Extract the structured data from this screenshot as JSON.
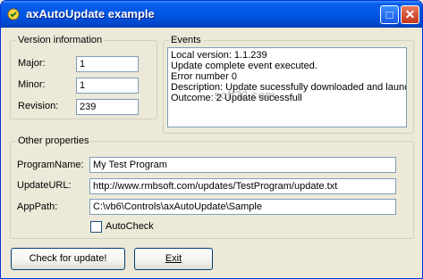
{
  "window": {
    "title": "axAutoUpdate example"
  },
  "titlebar_buttons": {
    "maximize": "□",
    "close": "✕"
  },
  "version_info": {
    "legend": "Version information",
    "major_label": "Major:",
    "major_value": "1",
    "minor_label": "Minor:",
    "minor_value": "1",
    "revision_label": "Revision:",
    "revision_value": "239"
  },
  "events": {
    "legend": "Events",
    "lines": [
      "Local version: 1.1.239",
      "Update complete event executed.",
      "Error number 0",
      "Description: Update sucessfully downloaded and launc",
      "Outcome: 2 Update sucessfull"
    ]
  },
  "other_properties": {
    "legend": "Other properties",
    "program_name_label": "ProgramName:",
    "program_name_value": "My Test Program",
    "update_url_label": "UpdateURL:",
    "update_url_value": "http://www.rmbsoft.com/updates/TestProgram/update.txt",
    "app_path_label": "AppPath:",
    "app_path_value": "C:\\vb6\\Controls\\axAutoUpdate\\Sample",
    "autocheck_label": "AutoCheck",
    "autocheck_checked": false
  },
  "buttons": {
    "check": "Check for update!",
    "exit": "Exit"
  },
  "watermark": "soft32.com"
}
